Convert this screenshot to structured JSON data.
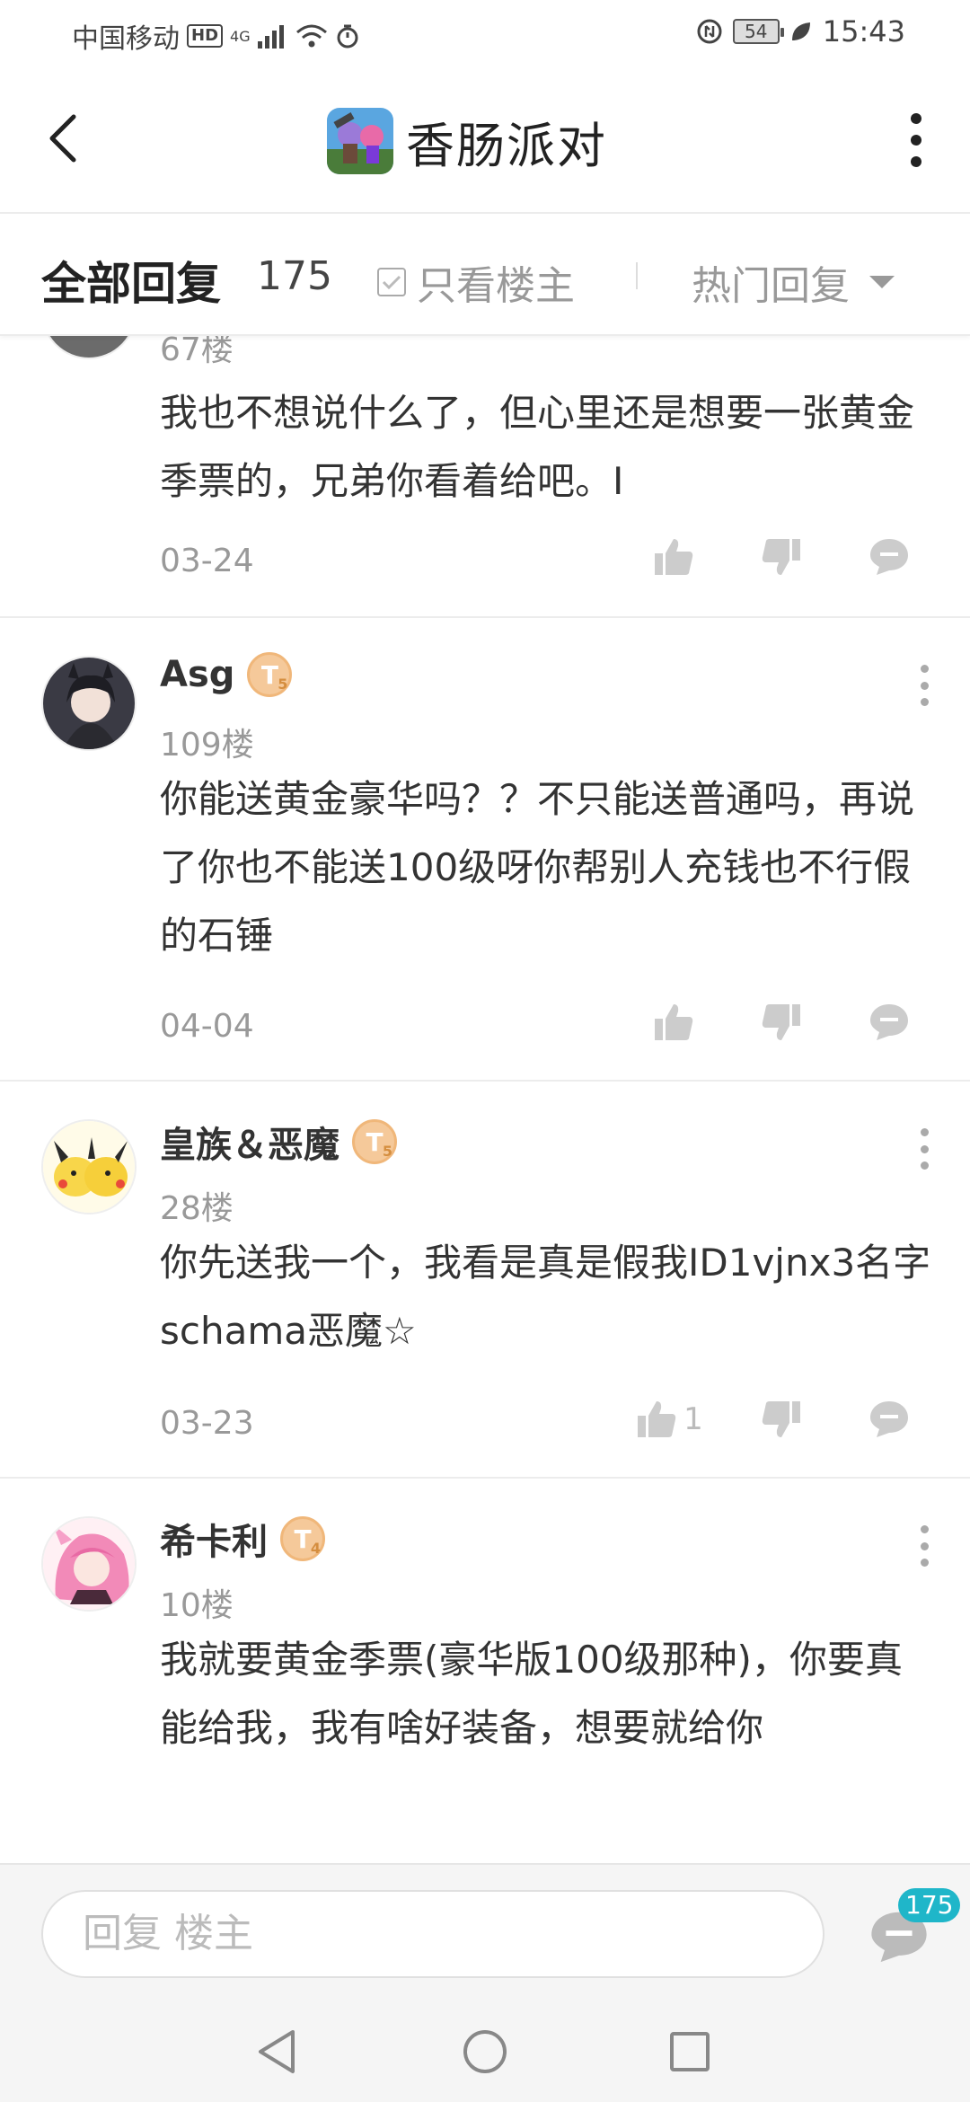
{
  "status_bar": {
    "carrier": "中国移动",
    "hd": "HD",
    "signal": "4G",
    "battery": "54",
    "time": "15:43"
  },
  "header": {
    "title": "香肠派对",
    "game_icon": "sausage-man-game-icon"
  },
  "filter": {
    "title": "全部回复",
    "count": "175",
    "only_owner": "只看楼主",
    "sort": "热门回复"
  },
  "replies": [
    {
      "floor": "67楼",
      "text": "我也不想说什么了，但心里还是想要一张黄金季票的，兄弟你看着给吧。I",
      "date": "03-24",
      "likes": ""
    },
    {
      "username": "Asg",
      "badge": "T",
      "badge_level": "5",
      "floor": "109楼",
      "text": "你能送黄金豪华吗？？不只能送普通吗，再说了你也不能送100级呀你帮别人充钱也不行假的石锤",
      "date": "04-04",
      "likes": ""
    },
    {
      "username": "皇族＆恶魔",
      "badge": "T",
      "badge_level": "5",
      "floor": "28楼",
      "text": "你先送我一个，我看是真是假我ID1vjnx3名字schama恶魔☆",
      "date": "03-23",
      "likes": "1"
    },
    {
      "username": "希卡利",
      "badge": "T",
      "badge_level": "4",
      "floor": "10楼",
      "text": "我就要黄金季票(豪华版100级那种)，你要真能给我，我有啥好装备，想要就给你"
    }
  ],
  "reply_bar": {
    "placeholder": "回复  楼主",
    "comment_count": "175"
  },
  "colors": {
    "accent": "#1fb6c9",
    "badge": "#f5c99a",
    "muted": "#999999"
  }
}
